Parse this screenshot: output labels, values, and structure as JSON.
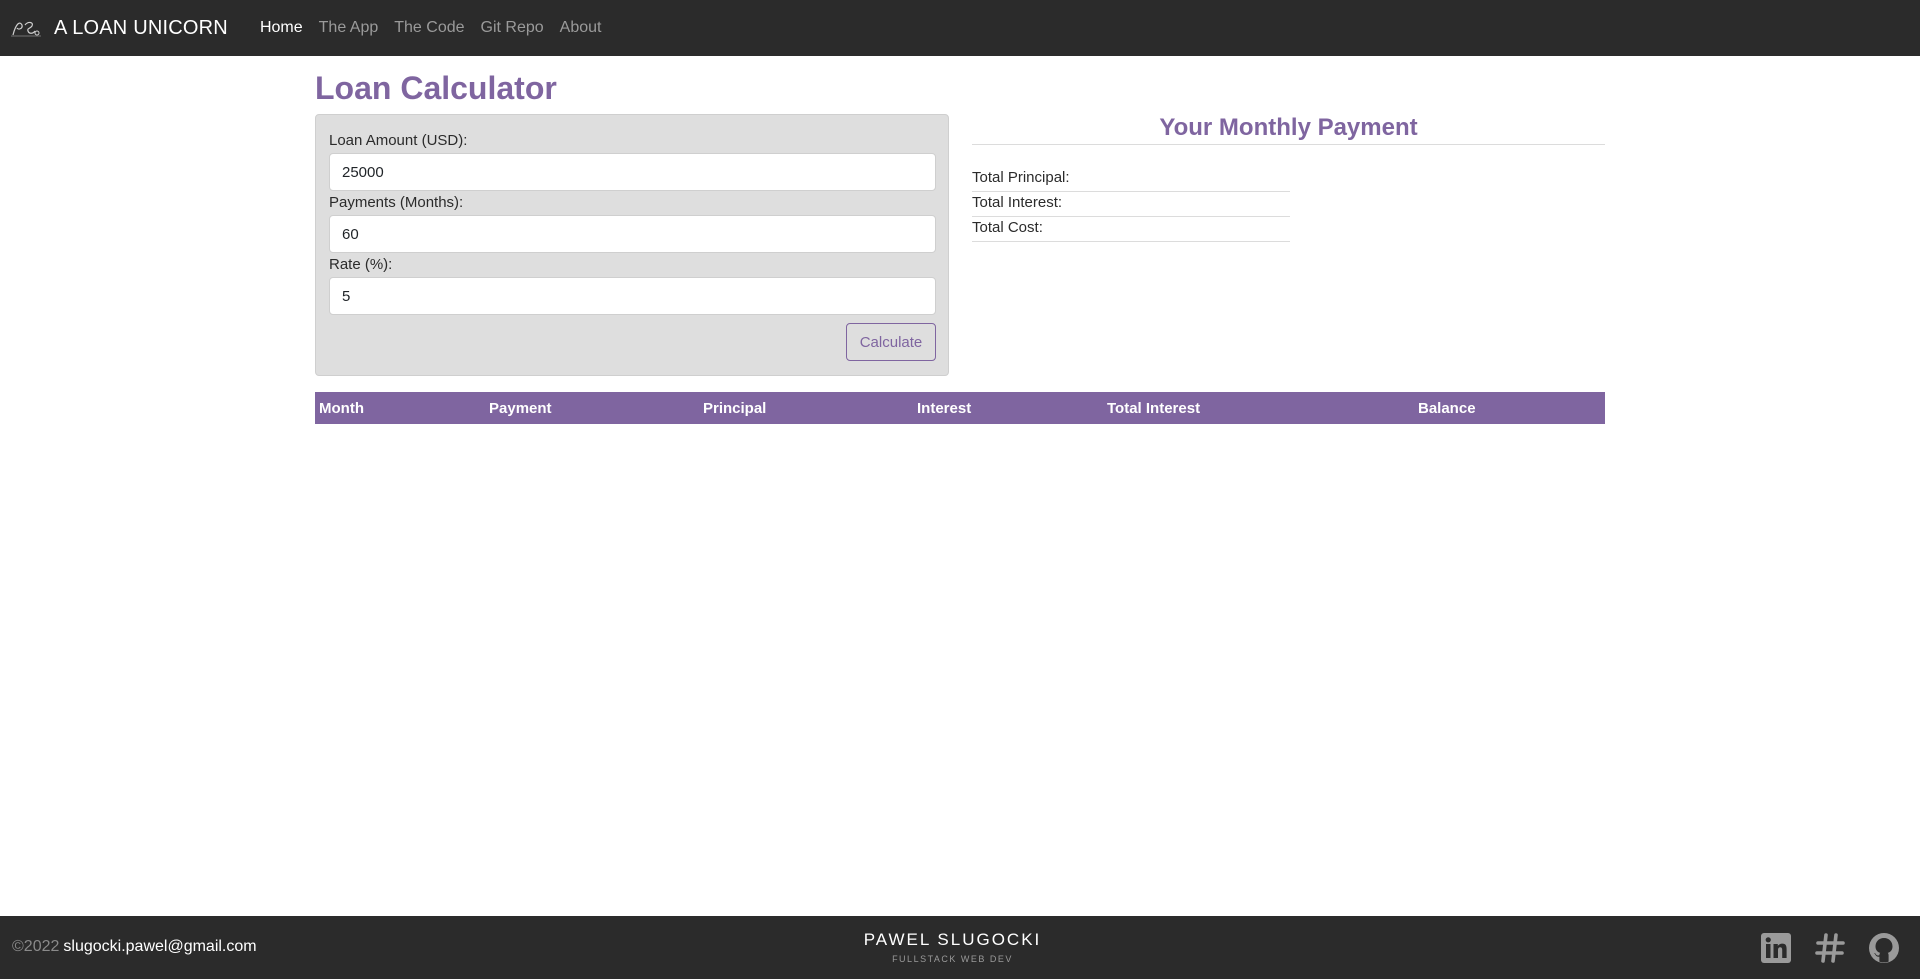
{
  "navbar": {
    "brand": "A LOAN UNICORN",
    "links": [
      "Home",
      "The App",
      "The Code",
      "Git Repo",
      "About"
    ]
  },
  "main": {
    "title": "Loan Calculator",
    "form": {
      "amount_label": "Loan Amount (USD):",
      "amount_value": "25000",
      "payments_label": "Payments (Months):",
      "payments_value": "60",
      "rate_label": "Rate (%):",
      "rate_value": "5",
      "calculate_label": "Calculate"
    },
    "results": {
      "title": "Your Monthly Payment",
      "total_principal_label": "Total Principal:",
      "total_interest_label": "Total Interest:",
      "total_cost_label": "Total Cost:"
    },
    "table": {
      "headers": [
        "Month",
        "Payment",
        "Principal",
        "Interest",
        "Total Interest",
        "Balance"
      ]
    }
  },
  "footer": {
    "copyright": "©2022",
    "email": "slugocki.pawel@gmail.com",
    "name": "PAWEL SLUGOCKI",
    "tagline": "FULLSTACK WEB DEV",
    "social_icons": [
      "linkedin-icon",
      "hashtag-icon",
      "github-icon"
    ]
  },
  "colors": {
    "accent": "#7f65a0",
    "navbar_bg": "#2b2b2b",
    "panel_bg": "#dedede"
  }
}
